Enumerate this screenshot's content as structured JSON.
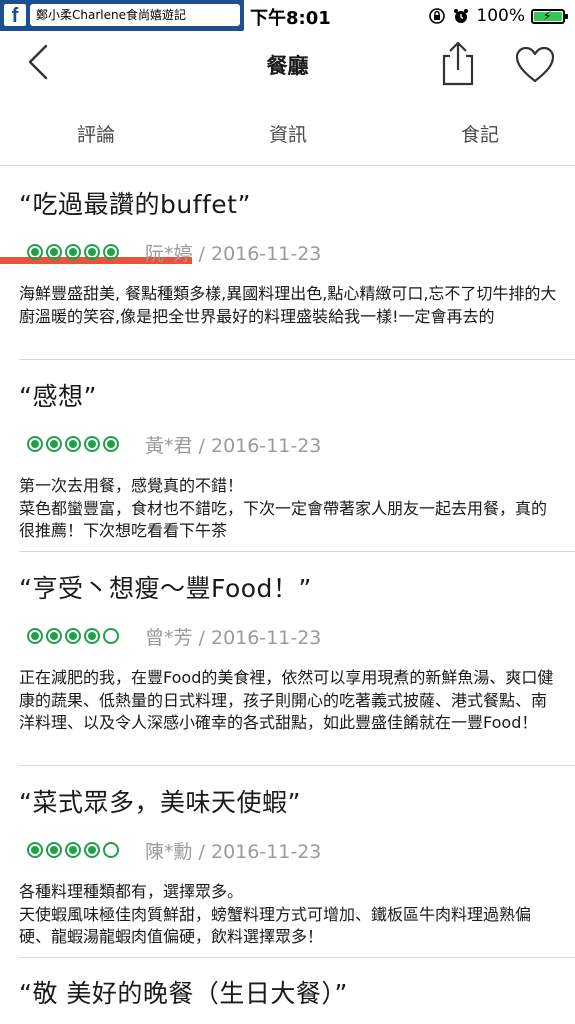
{
  "status_bar": {
    "back_app_label": "鄭小柔Charlene食尚嬉遊記",
    "back_app_icon": "facebook-icon",
    "time": "下午8:01",
    "battery_percent": "100%",
    "battery_level": 1.0,
    "icons": [
      "orientation-lock-icon",
      "alarm-icon",
      "battery-icon"
    ]
  },
  "navbar": {
    "title": "餐廳",
    "icons": [
      "back-chevron-icon",
      "share-icon",
      "heart-icon"
    ]
  },
  "tabs": [
    {
      "label": "評論",
      "active": true
    },
    {
      "label": "資訊",
      "active": false
    },
    {
      "label": "食記",
      "active": false
    }
  ],
  "colors": {
    "tab_indicator": "#e8533a",
    "rating_green": "#21a04a",
    "battery_green": "#35c759"
  },
  "reviews": [
    {
      "title": "“吃過最讚的buffet”",
      "rating": 5,
      "author_date": "阮*婷 / 2016-11-23",
      "body": "海鮮豐盛甜美, 餐點種類多樣,異國料理出色,點心精緻可口,忘不了切牛排的大廚溫暖的笑容,像是把全世界最好的料理盛裝給我一樣!一定會再去的"
    },
    {
      "title": "“感想”",
      "rating": 5,
      "author_date": "黃*君 / 2016-11-23",
      "body_lines": [
        "第一次去用餐，感覺真的不錯！",
        "菜色都蠻豐富，食材也不錯吃，下次一定會帶著家人朋友一起去用餐，真的很推薦！下次想吃看看下午茶"
      ]
    },
    {
      "title": "“亨受丶想瘦～豐Food！”",
      "rating": 4,
      "author_date": "曾*芳 / 2016-11-23",
      "body": "正在減肥的我，在豐Food的美食裡，依然可以享用現煮的新鮮魚湯、爽口健康的蔬果、低熱量的日式料理，孩子則開心的吃著義式披薩、港式餐點、南洋料理、以及令人深感小確幸的各式甜點，如此豐盛佳餚就在一豐Food！"
    },
    {
      "title": "“菜式眾多，美味天使蝦”",
      "rating": 4,
      "author_date": "陳*勳 / 2016-11-23",
      "body_lines": [
        "各種料理種類都有，選擇眾多。",
        "天使蝦風味極佳肉質鮮甜，螃蟹料理方式可增加、鐵板區牛肉料理過熟偏硬、龍蝦湯龍蝦肉值偏硬，飲料選擇眾多！"
      ]
    },
    {
      "title": "“敬 美好的晚餐（生日大餐）”",
      "rating": null,
      "author_date": "",
      "body": ""
    }
  ]
}
